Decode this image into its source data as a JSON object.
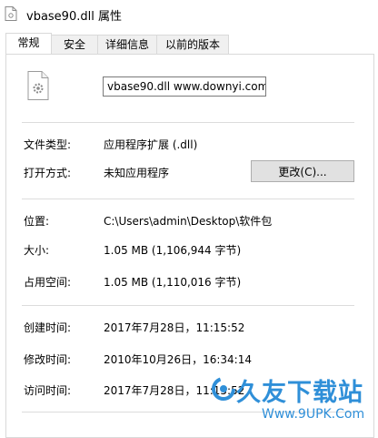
{
  "window": {
    "title": "vbase90.dll 属性"
  },
  "tabs": [
    {
      "label": "常规",
      "active": true
    },
    {
      "label": "安全",
      "active": false
    },
    {
      "label": "详细信息",
      "active": false
    },
    {
      "label": "以前的版本",
      "active": false
    }
  ],
  "general": {
    "filename_value": "vbase90.dll www.downyi.com",
    "file_type_label": "文件类型:",
    "file_type_value": "应用程序扩展 (.dll)",
    "opens_with_label": "打开方式:",
    "opens_with_value": "未知应用程序",
    "change_button": "更改(C)...",
    "location_label": "位置:",
    "location_value": "C:\\Users\\admin\\Desktop\\软件包",
    "size_label": "大小:",
    "size_value": "1.05 MB (1,106,944 字节)",
    "size_on_disk_label": "占用空间:",
    "size_on_disk_value": "1.05 MB (1,110,016 字节)",
    "created_label": "创建时间:",
    "created_value": "2017年7月28日，11:15:52",
    "modified_label": "修改时间:",
    "modified_value": "2010年10月26日，16:34:14",
    "accessed_label": "访问时间:",
    "accessed_value": "2017年7月28日，11:15:52"
  },
  "watermark": {
    "text": "久友下载站",
    "url": "Www.9UPK.Com"
  },
  "colors": {
    "accent": "#2f8fd8",
    "border": "#d9d9d9",
    "button": "#e1e1e1"
  }
}
